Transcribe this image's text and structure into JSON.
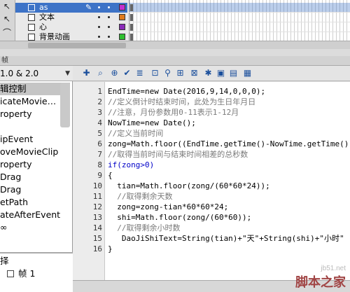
{
  "timeline": {
    "layers": [
      {
        "name": "as",
        "selected": true,
        "swatch": "#c42fcf"
      },
      {
        "name": "文本",
        "selected": false,
        "swatch": "#e07a1a"
      },
      {
        "name": "心",
        "selected": false,
        "swatch": "#8a2ab8"
      },
      {
        "name": "背景动画",
        "selected": false,
        "swatch": "#2fbf2f"
      }
    ]
  },
  "panel": {
    "title": "帧"
  },
  "left": {
    "version": "1.0 & 2.0",
    "actions": [
      "辑控制",
      "icateMovie…",
      "roperty",
      "",
      "ipEvent",
      "oveMovieClip",
      "roperty",
      "Drag",
      "Drag",
      "etPath",
      "ateAfterEvent",
      "∞"
    ],
    "nav": [
      "择",
      "帧 1"
    ]
  },
  "editor": {
    "line_numbers": [
      "1",
      "2",
      "3",
      "4",
      "5",
      "6",
      "7",
      "8",
      "9",
      "10",
      "11",
      "12",
      "13",
      "14",
      "15",
      "16"
    ],
    "lines": [
      "EndTime=new Date(2016,9,14,0,0,0);",
      "//定义倒计时结束时间，此处为生日年月日",
      "//注意，月份参数用0-11表示1-12月",
      "NowTime=new Date();",
      "//定义当前时间",
      "zong=Math.floor((EndTime.getTime()-NowTime.getTime()",
      "//取得当前时间与结束时间相差的总秒数",
      "if(zong>0)",
      "{",
      "  tian=Math.floor(zong/(60*60*24));",
      "  //取得剩余天数",
      "  zong=zong-tian*60*60*24;",
      "  shi=Math.floor(zong/(60*60));",
      "  //取得剩余小时数",
      "   DaoJiShiText=String(tian)+\"天\"+String(shi)+\"小时\"",
      "}"
    ]
  },
  "watermark": {
    "domain": "jb51.net",
    "brand": "脚本之家"
  }
}
